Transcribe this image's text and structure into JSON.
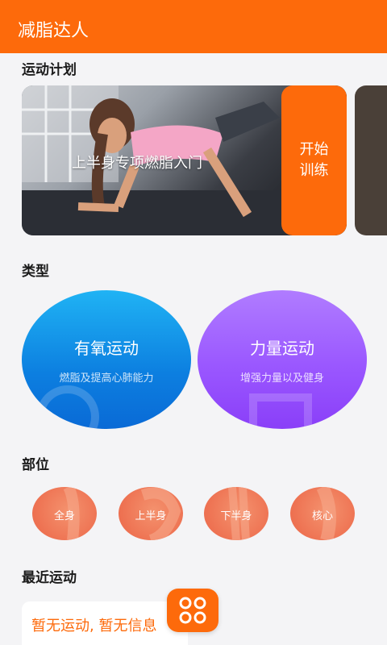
{
  "app": {
    "title": "减脂达人"
  },
  "sections": {
    "plan": "运动计划",
    "type": "类型",
    "part": "部位",
    "recent": "最近运动"
  },
  "plan_card": {
    "name": "上半身专项燃脂入门",
    "start_label": "开始训练"
  },
  "types": [
    {
      "title": "有氧运动",
      "subtitle": "燃脂及提高心肺能力",
      "color": "#0c7fe0"
    },
    {
      "title": "力量运动",
      "subtitle": "增强力量以及健身",
      "color": "#9a57ff"
    }
  ],
  "parts": [
    "全身",
    "上半身",
    "下半身",
    "核心"
  ],
  "recent": {
    "empty_text": "暂无运动, 暂无信息"
  },
  "colors": {
    "accent": "#fd6a0b",
    "background": "#f4f4f6",
    "part": "#ee7252"
  },
  "icons": {
    "fab": "grid-circles-icon"
  }
}
